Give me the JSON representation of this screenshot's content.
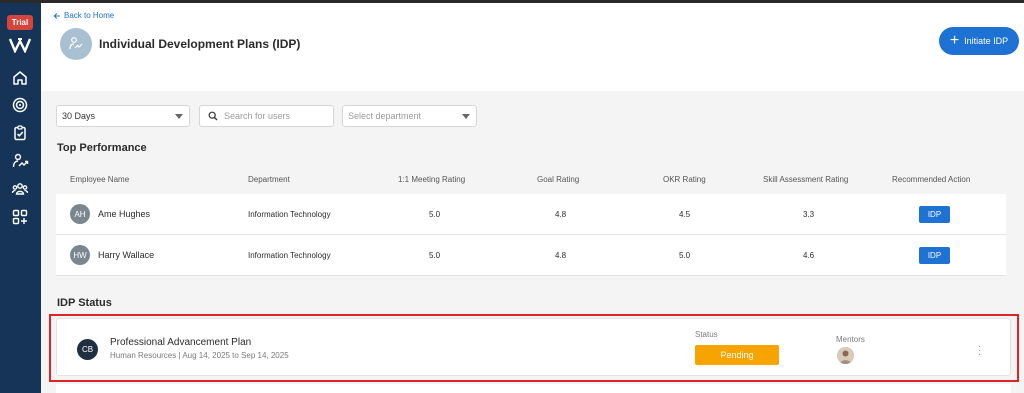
{
  "sidebar": {
    "trial_badge": "Trial",
    "icons": [
      "home-icon",
      "target-icon",
      "clipboard-check-icon",
      "growth-person-icon",
      "team-icon",
      "apps-add-icon"
    ]
  },
  "header": {
    "back_label": "Back to Home",
    "title": "Individual Development Plans (IDP)",
    "initiate_label": "Initiate IDP"
  },
  "filters": {
    "period_value": "30 Days",
    "search_placeholder": "Search for users",
    "department_placeholder": "Select department"
  },
  "top_performance": {
    "title": "Top Performance",
    "columns": [
      "Employee Name",
      "Department",
      "1:1 Meeting Rating",
      "Goal Rating",
      "OKR Rating",
      "Skill Assessment Rating",
      "Recommended Action"
    ],
    "rows": [
      {
        "initials": "AH",
        "name": "Ame Hughes",
        "department": "Information Technology",
        "meeting": "5.0",
        "goal": "4.8",
        "okr": "4.5",
        "skill": "3.3",
        "action": "IDP"
      },
      {
        "initials": "HW",
        "name": "Harry Wallace",
        "department": "Information Technology",
        "meeting": "5.0",
        "goal": "4.8",
        "okr": "5.0",
        "skill": "4.6",
        "action": "IDP"
      }
    ]
  },
  "idp_status": {
    "title": "IDP Status",
    "plan": {
      "initials": "CB",
      "title": "Professional Advancement Plan",
      "subtitle": "Human Resources | Aug 14, 2025 to Sep 14, 2025",
      "status_label": "Status",
      "status_value": "Pending",
      "mentors_label": "Mentors"
    }
  },
  "colors": {
    "sidebar": "#163457",
    "primary": "#1e72d4",
    "pending": "#f7a400",
    "highlight": "#e0242a",
    "trial": "#d6453b"
  }
}
